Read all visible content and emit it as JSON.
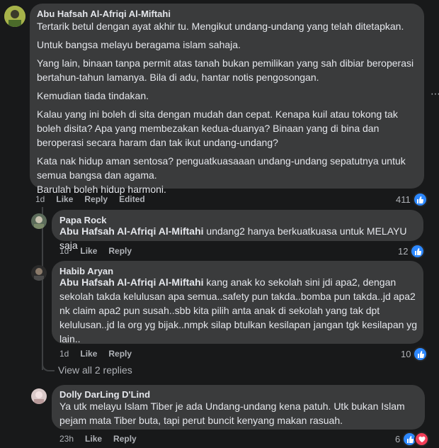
{
  "comments": [
    {
      "author": "Abu Hafsah Al-Afriqi Al-Miftahi",
      "paragraphs": [
        "Tertarik betul dengan ayat akhir tu. Mengikut undang-undang yang telah ditetapkan.",
        "Untuk bangsa melayu beragama islam sahaja.",
        "Yang lain, binaan tanpa permit atas tanah bukan pemilikan yang sah dibiar beroperasi bertahun-tahun lamanya. Bila di adu, hantar notis pengosongan.",
        "Kemudian tiada tindakan.",
        "Kalau yang ini boleh di sita dengan mudah dan cepat. Kenapa kuil atau tokong tak boleh disita? Apa yang membezakan kedua-duanya? Binaan yang di bina dan beroperasi secara haram dan tak ikut undang-undang?",
        "Kata nak hidup aman sentosa? penguatkuasaaan undang-undang sepatutnya untuk semua bangsa dan agama.",
        "Barulah boleh hidup harmoni."
      ],
      "time": "1d",
      "actions": [
        "Like",
        "Reply",
        "Edited"
      ],
      "reactions": "411"
    }
  ],
  "replies": [
    {
      "author": "Papa Rock",
      "mention": "Abu Hafsah Al-Afriqi Al-Miftahi",
      "text": " undang2 hanya berkuatkuasa untuk MELAYU saja",
      "time": "1d",
      "actions": [
        "Like",
        "Reply"
      ],
      "reactions": "12"
    },
    {
      "author": "Habib Aryan",
      "mention": "Abu Hafsah Al-Afriqi Al-Miftahi",
      "text": " kang anak ko sekolah sini jdi apa2, dengan sekolah takda kelulusan apa semua..safety pun takda..bomba pun takda..jd apa2 nk claim apa2 pun susah..sbb kita pilih anta anak di sekolah yang tak dpt kelulusan..jd la org yg bijak..nmpk silap btulkan kesilapan jangan tgk kesilapan yg lain..",
      "time": "1d",
      "actions": [
        "Like",
        "Reply"
      ],
      "reactions": "10"
    }
  ],
  "view_replies": "View all 2 replies",
  "comment3": {
    "author": "Dolly DarLing D'Lind",
    "text": "Ya utk melayu Islam Tiber je ada Undang-undang kena patuh. Utk bukan Islam pejam mata Tiber buta, tapi perut buncit kenyang makan rasuah.",
    "time": "23h",
    "actions": [
      "Like",
      "Reply"
    ],
    "reactions": "6"
  },
  "icons": {
    "like": "like-icon",
    "love": "love-icon",
    "more": "more-options-icon"
  },
  "colors": {
    "background": "#18191a",
    "bubble": "#3a3b3c",
    "like": "#2d88ff",
    "love": "#f33e58"
  }
}
